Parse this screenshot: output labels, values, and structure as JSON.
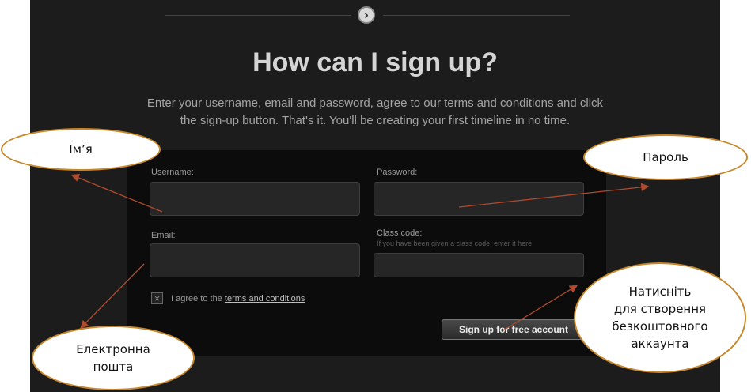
{
  "page": {
    "headline": "How can I sign up?",
    "intro_line1": "Enter your username, email and password, agree to our terms and conditions and click",
    "intro_line2": "the sign-up button. That's it. You'll be creating your first timeline in no time.",
    "nav_icon": "chevron-right-icon"
  },
  "form": {
    "username_label": "Username:",
    "username_value": "",
    "password_label": "Password:",
    "password_value": "",
    "email_label": "Email:",
    "email_value": "",
    "class_code_label": "Class code:",
    "class_code_hint": "If you have been given a class code, enter it here",
    "class_code_value": "",
    "agree_prefix": "I agree to the ",
    "agree_link": "terms and conditions",
    "agree_checked": false,
    "signup_button": "Sign up for free account"
  },
  "callouts": {
    "name": "Ім’я",
    "password": "Пароль",
    "email_line1": "Електронна",
    "email_line2": "пошта",
    "button_line1": "Натисніть",
    "button_line2": "для створення",
    "button_line3": "безкоштовного",
    "button_line4": "аккаунта"
  },
  "colors": {
    "panel_background": "#1c1c1c",
    "form_background": "#0c0c0c",
    "callout_border": "#c8872b",
    "arrow": "#b04a2e"
  }
}
